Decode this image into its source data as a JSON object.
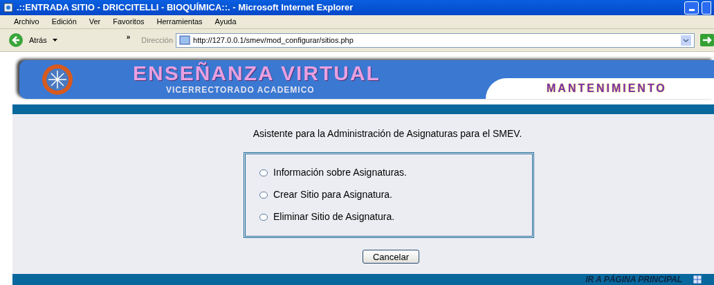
{
  "window": {
    "title": ".::ENTRADA SITIO - DRICCITELLI - BIOQUÍMICA::. - Microsoft Internet Explorer"
  },
  "menu": [
    "Archivo",
    "Edición",
    "Ver",
    "Favoritos",
    "Herramientas",
    "Ayuda"
  ],
  "toolbar": {
    "back": "Atrás",
    "more": "»",
    "address_label": "Dirección",
    "address": "http://127.0.0.1/smev/mod_configurar/sitios.php"
  },
  "banner": {
    "title": "ENSEÑANZA VIRTUAL",
    "subtitle": "VICERRECTORADO ACADEMICO",
    "section": "MANTENIMIENTO"
  },
  "heading": "Asistente para la Administración de Asignaturas para el SMEV.",
  "options": [
    {
      "label": "Información sobre Asignaturas.",
      "selected": false
    },
    {
      "label": "Crear Sitio para Asignatura.",
      "selected": false
    },
    {
      "label": "Eliminar Sitio de Asignatura.",
      "selected": false
    }
  ],
  "cancel_button": "Cancelar",
  "footer_link": "IR A PÁGINA PRINCIPAL"
}
